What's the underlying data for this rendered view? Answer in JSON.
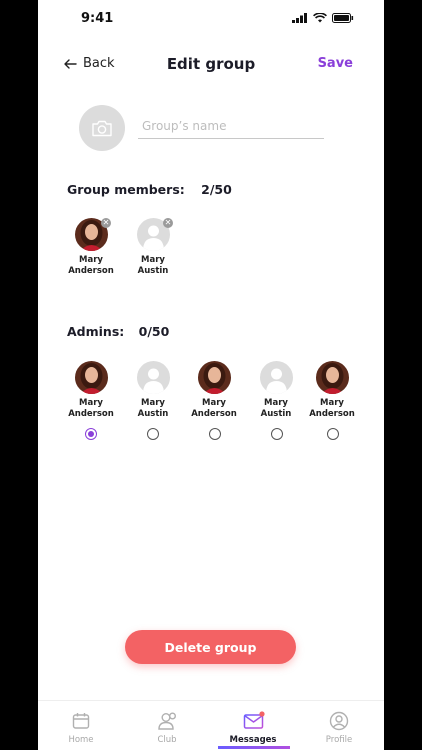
{
  "status_bar": {
    "time": "9:41"
  },
  "header": {
    "back_label": "Back",
    "title": "Edit group",
    "save_label": "Save"
  },
  "group_name_input": {
    "value": "",
    "placeholder": "Group’s name"
  },
  "members_section": {
    "label": "Group members:",
    "count": "2/50",
    "members": [
      {
        "first": "Mary",
        "last": "Anderson",
        "has_photo": true
      },
      {
        "first": "Mary",
        "last": "Austin",
        "has_photo": false
      }
    ]
  },
  "admins_section": {
    "label": "Admins:",
    "count": "0/50",
    "candidates": [
      {
        "first": "Mary",
        "last": "Anderson",
        "has_photo": true,
        "selected": true
      },
      {
        "first": "Mary",
        "last": "Austin",
        "has_photo": false,
        "selected": false
      },
      {
        "first": "Mary",
        "last": "Anderson",
        "has_photo": true,
        "selected": false
      },
      {
        "first": "Mary",
        "last": "Austin",
        "has_photo": false,
        "selected": false
      },
      {
        "first": "Mary",
        "last": "Anderson",
        "has_photo": true,
        "selected": false
      }
    ]
  },
  "delete_button": {
    "label": "Delete group"
  },
  "tabbar": {
    "tabs": [
      {
        "label": "Home",
        "icon": "calendar-icon",
        "active": false
      },
      {
        "label": "Club",
        "icon": "users-icon",
        "active": false
      },
      {
        "label": "Messages",
        "icon": "envelope-icon",
        "active": true
      },
      {
        "label": "Profile",
        "icon": "user-circle-icon",
        "active": false
      }
    ]
  },
  "colors": {
    "accent": "#8a3fd9",
    "danger": "#f36264",
    "placeholder_avatar": "#dcdcdc"
  }
}
